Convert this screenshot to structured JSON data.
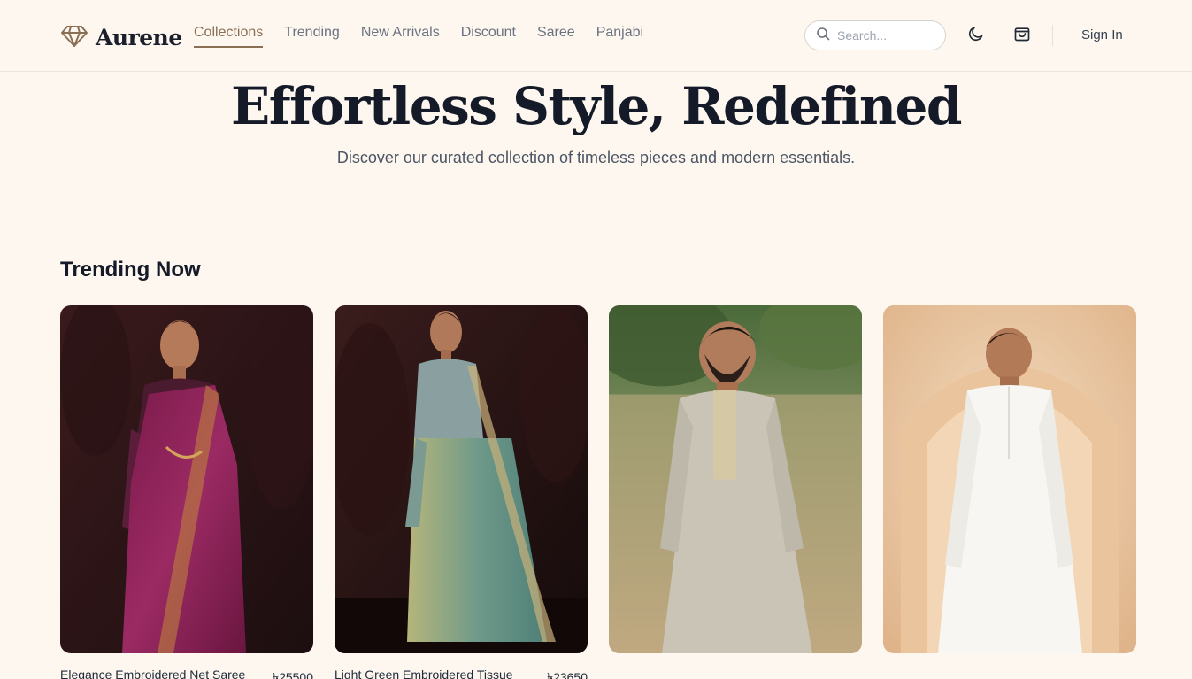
{
  "brand": {
    "name": "Aurene",
    "icon": "diamond-icon"
  },
  "nav": {
    "items": [
      {
        "label": "Collections",
        "active": true
      },
      {
        "label": "Trending"
      },
      {
        "label": "New Arrivals"
      },
      {
        "label": "Discount"
      },
      {
        "label": "Saree"
      },
      {
        "label": "Panjabi"
      }
    ]
  },
  "search": {
    "placeholder": "Search..."
  },
  "header": {
    "signin_label": "Sign In",
    "theme_icon": "moon-icon",
    "cart_icon": "shopping-bag-icon"
  },
  "hero": {
    "title": "Effortless Style, Redefined",
    "subtitle": "Discover our curated collection of timeless pieces and modern essentials."
  },
  "trending": {
    "title": "Trending Now",
    "products": [
      {
        "name": "Elegance Embroidered Net Saree",
        "price": "৳25500"
      },
      {
        "name": "Light Green Embroidered Tissue",
        "price": "৳23650"
      },
      {
        "name": "",
        "price": ""
      },
      {
        "name": "",
        "price": ""
      }
    ]
  },
  "colors": {
    "accent": "#8b6f55",
    "background": "#fdf7f0",
    "text": "#141a27"
  }
}
